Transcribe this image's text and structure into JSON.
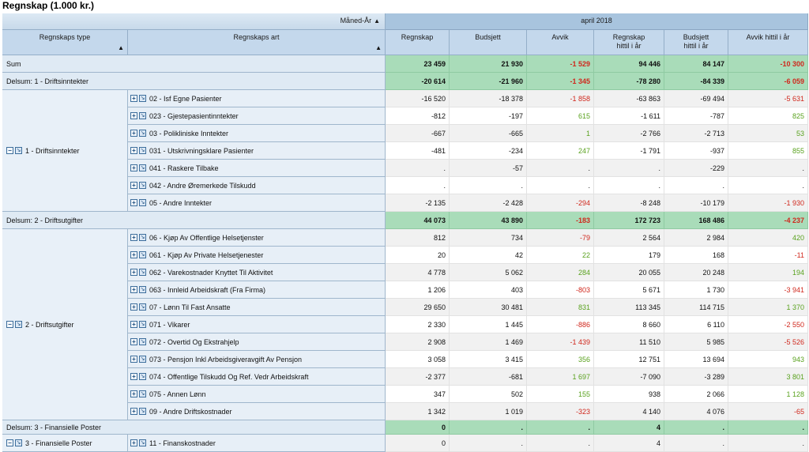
{
  "page_title": "Regnskap (1.000 kr.)",
  "header": {
    "dim_pivot_label": "Måned-År",
    "period_label": "april 2018",
    "row_dim_1": "Regnskaps type",
    "row_dim_2": "Regnskaps art",
    "columns": [
      {
        "line1": "Regnskap",
        "line2": ""
      },
      {
        "line1": "Budsjett",
        "line2": ""
      },
      {
        "line1": "Avvik",
        "line2": ""
      },
      {
        "line1": "Regnskap",
        "line2": "hittil i år"
      },
      {
        "line1": "Budsjett",
        "line2": "hittil i år"
      },
      {
        "line1": "Avvik hittil i år",
        "line2": ""
      }
    ]
  },
  "icons": {
    "expand": "+",
    "collapse": "−",
    "drill": "↘",
    "sort": "▲"
  },
  "colors": {
    "negative": "#d0281d",
    "positive": "#5aa21f",
    "sum_bg": "#a9dcb9",
    "header_bg": "#a8c4de"
  },
  "groups": [
    {
      "label": "1 - Driftsinntekter",
      "start": 2,
      "end": 8
    },
    {
      "label": "2 - Driftsutgifter",
      "start": 10,
      "end": 20
    },
    {
      "label": "3 - Finansielle Poster",
      "start": 22,
      "end": 22
    }
  ],
  "rows": [
    {
      "kind": "sum",
      "label": "Sum",
      "values": [
        "23 459",
        "21 930",
        "-1 529",
        "94 446",
        "84 147",
        "-10 300"
      ],
      "tone": [
        "",
        "",
        "neg",
        "",
        "",
        "neg"
      ]
    },
    {
      "kind": "subtotal",
      "label": "Delsum: 1 - Driftsinntekter",
      "values": [
        "-20 614",
        "-21 960",
        "-1 345",
        "-78 280",
        "-84 339",
        "-6 059"
      ],
      "tone": [
        "",
        "",
        "neg",
        "",
        "",
        "neg"
      ]
    },
    {
      "kind": "detail",
      "label": "02 - Isf Egne Pasienter",
      "values": [
        "-16 520",
        "-18 378",
        "-1 858",
        "-63 863",
        "-69 494",
        "-5 631"
      ],
      "tone": [
        "",
        "",
        "neg",
        "",
        "",
        "neg"
      ]
    },
    {
      "kind": "detail",
      "label": "023 - Gjestepasientinntekter",
      "values": [
        "-812",
        "-197",
        "615",
        "-1 611",
        "-787",
        "825"
      ],
      "tone": [
        "",
        "",
        "pos",
        "",
        "",
        "pos"
      ]
    },
    {
      "kind": "detail",
      "label": "03 - Polikliniske Inntekter",
      "values": [
        "-667",
        "-665",
        "1",
        "-2 766",
        "-2 713",
        "53"
      ],
      "tone": [
        "",
        "",
        "pos",
        "",
        "",
        "pos"
      ]
    },
    {
      "kind": "detail",
      "label": "031 - Utskrivningsklare Pasienter",
      "values": [
        "-481",
        "-234",
        "247",
        "-1 791",
        "-937",
        "855"
      ],
      "tone": [
        "",
        "",
        "pos",
        "",
        "",
        "pos"
      ]
    },
    {
      "kind": "detail",
      "label": "041 - Raskere Tilbake",
      "values": [
        ".",
        "-57",
        ".",
        ".",
        "-229",
        "."
      ],
      "tone": [
        "",
        "",
        "",
        "",
        "",
        ""
      ]
    },
    {
      "kind": "detail",
      "label": "042 - Andre Øremerkede Tilskudd",
      "values": [
        ".",
        ".",
        ".",
        ".",
        ".",
        "."
      ],
      "tone": [
        "",
        "",
        "",
        "",
        "",
        ""
      ]
    },
    {
      "kind": "detail",
      "label": "05 - Andre Inntekter",
      "values": [
        "-2 135",
        "-2 428",
        "-294",
        "-8 248",
        "-10 179",
        "-1 930"
      ],
      "tone": [
        "",
        "",
        "neg",
        "",
        "",
        "neg"
      ]
    },
    {
      "kind": "subtotal",
      "label": "Delsum: 2 - Driftsutgifter",
      "values": [
        "44 073",
        "43 890",
        "-183",
        "172 723",
        "168 486",
        "-4 237"
      ],
      "tone": [
        "",
        "",
        "neg",
        "",
        "",
        "neg"
      ]
    },
    {
      "kind": "detail",
      "label": "06 - Kjøp Av Offentlige Helsetjenster",
      "values": [
        "812",
        "734",
        "-79",
        "2 564",
        "2 984",
        "420"
      ],
      "tone": [
        "",
        "",
        "neg",
        "",
        "",
        "pos"
      ]
    },
    {
      "kind": "detail",
      "label": "061 - Kjøp Av Private Helsetjenester",
      "values": [
        "20",
        "42",
        "22",
        "179",
        "168",
        "-11"
      ],
      "tone": [
        "",
        "",
        "pos",
        "",
        "",
        "neg"
      ]
    },
    {
      "kind": "detail",
      "label": "062 - Varekostnader Knyttet Til Aktivitet",
      "values": [
        "4 778",
        "5 062",
        "284",
        "20 055",
        "20 248",
        "194"
      ],
      "tone": [
        "",
        "",
        "pos",
        "",
        "",
        "pos"
      ]
    },
    {
      "kind": "detail",
      "label": "063 - Innleid Arbeidskraft (Fra Firma)",
      "values": [
        "1 206",
        "403",
        "-803",
        "5 671",
        "1 730",
        "-3 941"
      ],
      "tone": [
        "",
        "",
        "neg",
        "",
        "",
        "neg"
      ]
    },
    {
      "kind": "detail",
      "label": "07 - Lønn Til Fast Ansatte",
      "values": [
        "29 650",
        "30 481",
        "831",
        "113 345",
        "114 715",
        "1 370"
      ],
      "tone": [
        "",
        "",
        "pos",
        "",
        "",
        "pos"
      ]
    },
    {
      "kind": "detail",
      "label": "071 - Vikarer",
      "values": [
        "2 330",
        "1 445",
        "-886",
        "8 660",
        "6 110",
        "-2 550"
      ],
      "tone": [
        "",
        "",
        "neg",
        "",
        "",
        "neg"
      ]
    },
    {
      "kind": "detail",
      "label": "072 - Overtid Og Ekstrahjelp",
      "values": [
        "2 908",
        "1 469",
        "-1 439",
        "11 510",
        "5 985",
        "-5 526"
      ],
      "tone": [
        "",
        "",
        "neg",
        "",
        "",
        "neg"
      ]
    },
    {
      "kind": "detail",
      "label": "073 - Pensjon Inkl Arbeidsgiveravgift Av Pensjon",
      "values": [
        "3 058",
        "3 415",
        "356",
        "12 751",
        "13 694",
        "943"
      ],
      "tone": [
        "",
        "",
        "pos",
        "",
        "",
        "pos"
      ]
    },
    {
      "kind": "detail",
      "label": "074 - Offentlige Tilskudd Og Ref. Vedr Arbeidskraft",
      "values": [
        "-2 377",
        "-681",
        "1 697",
        "-7 090",
        "-3 289",
        "3 801"
      ],
      "tone": [
        "",
        "",
        "pos",
        "",
        "",
        "pos"
      ]
    },
    {
      "kind": "detail",
      "label": "075 - Annen Lønn",
      "values": [
        "347",
        "502",
        "155",
        "938",
        "2 066",
        "1 128"
      ],
      "tone": [
        "",
        "",
        "pos",
        "",
        "",
        "pos"
      ]
    },
    {
      "kind": "detail",
      "label": "09 - Andre Driftskostnader",
      "values": [
        "1 342",
        "1 019",
        "-323",
        "4 140",
        "4 076",
        "-65"
      ],
      "tone": [
        "",
        "",
        "neg",
        "",
        "",
        "neg"
      ]
    },
    {
      "kind": "subtotal",
      "label": "Delsum: 3 - Finansielle Poster",
      "values": [
        "0",
        ".",
        ".",
        "4",
        ".",
        "."
      ],
      "tone": [
        "",
        "",
        "",
        "",
        "",
        ""
      ]
    },
    {
      "kind": "detail",
      "label": "11 - Finanskostnader",
      "values": [
        "0",
        ".",
        ".",
        "4",
        ".",
        "."
      ],
      "tone": [
        "",
        "",
        "",
        "",
        "",
        ""
      ]
    }
  ]
}
